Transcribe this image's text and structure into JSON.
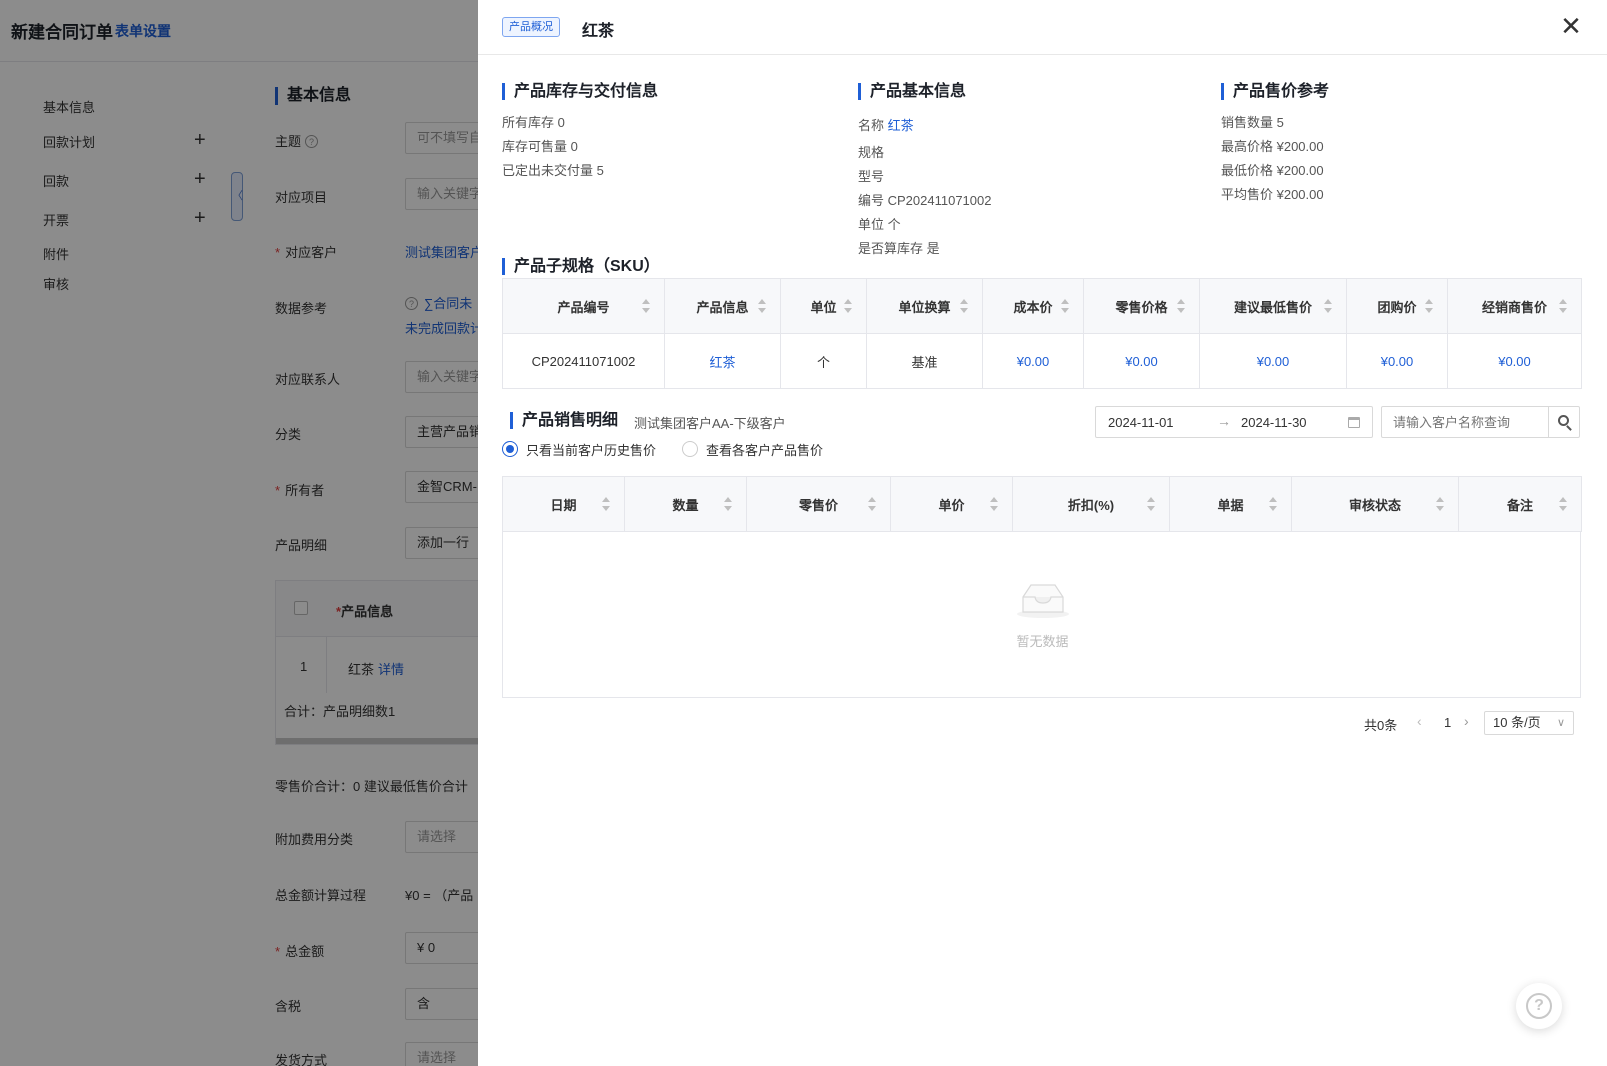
{
  "background": {
    "title": "新建合同订单",
    "form_setting": "表单设置",
    "nav": [
      {
        "label": "基本信息",
        "plus": false
      },
      {
        "label": "回款计划",
        "plus": true
      },
      {
        "label": "回款",
        "plus": true
      },
      {
        "label": "开票",
        "plus": true
      },
      {
        "label": "附件",
        "plus": false
      },
      {
        "label": "审核",
        "plus": false
      }
    ],
    "collapse_glyph": "〈",
    "section_title": "基本信息",
    "fields": {
      "subject_label": "主题",
      "subject_placeholder": "可不填写自",
      "project_label": "对应项目",
      "project_placeholder": "输入关键字",
      "customer_label": "对应客户",
      "customer_value": "测试集团客户",
      "data_ref_label": "数据参考",
      "data_ref_line1": "∑合同未",
      "data_ref_line2": "未完成回款计",
      "contact_label": "对应联系人",
      "contact_placeholder": "输入关键字",
      "category_label": "分类",
      "category_value": "主营产品销",
      "owner_label": "所有者",
      "owner_value": "金智CRM-",
      "product_detail_label": "产品明细",
      "product_detail_value": "添加一行",
      "retail_total": "零售价合计：0  建议最低售价合计",
      "extra_fee_label": "附加费用分类",
      "extra_fee_placeholder": "请选择",
      "calc_label": "总金额计算过程",
      "calc_value": "¥0 = （产品",
      "total_label": "总金额",
      "total_value": "¥  0",
      "tax_label": "含税",
      "tax_value": "含",
      "ship_label": "发货方式",
      "ship_placeholder": "请选择",
      "required_mark": "*"
    },
    "product_table": {
      "header": "产品信息",
      "row_index": "1",
      "row_name": "红茶",
      "row_link": "详情",
      "total": "合计：产品明细数1"
    }
  },
  "drawer": {
    "tag": "产品概况",
    "title": "红茶",
    "close_glyph": "✕",
    "inventory": {
      "title": "产品库存与交付信息",
      "lines": [
        "所有库存  0",
        "库存可售量  0",
        "已定出未交付量  5"
      ]
    },
    "basic": {
      "title": "产品基本信息",
      "name_label": "名称",
      "name_value": "红茶",
      "lines": [
        "规格",
        "型号",
        "编号 CP202411071002",
        "单位 个",
        "是否算库存 是"
      ]
    },
    "price_ref": {
      "title": "产品售价参考",
      "lines": [
        "销售数量 5",
        "最高价格 ¥200.00",
        "最低价格 ¥200.00",
        "平均售价 ¥200.00"
      ]
    },
    "sku": {
      "title": "产品子规格（SKU）",
      "columns": [
        "产品编号",
        "产品信息",
        "单位",
        "单位换算",
        "成本价",
        "零售价格",
        "建议最低售价",
        "团购价",
        "经销商售价"
      ],
      "rows": [
        [
          "CP202411071002",
          "红茶",
          "个",
          "基准",
          "¥0.00",
          "¥0.00",
          "¥0.00",
          "¥0.00",
          "¥0.00"
        ]
      ]
    },
    "sales": {
      "title": "产品销售明细",
      "subtitle": "测试集团客户AA-下级客户",
      "date_start": "2024-11-01",
      "date_arrow": "→",
      "date_end": "2024-11-30",
      "search_placeholder": "请输入客户名称查询",
      "radio_current": "只看当前客户历史售价",
      "radio_all": "查看各客户产品售价",
      "selected_radio": "current",
      "columns": [
        "日期",
        "数量",
        "零售价",
        "单价",
        "折扣(%)",
        "单据",
        "审核状态",
        "备注"
      ],
      "empty_text": "暂无数据"
    },
    "pager": {
      "total": "共0条",
      "prev": "‹",
      "page": "1",
      "next": "›",
      "size": "10 条/页",
      "size_chevron": "∨"
    },
    "help": "?"
  },
  "colors": {
    "accent": "#1f5fd6",
    "required": "#e03c3c",
    "mask": "rgba(0,0,0,0.45)"
  }
}
